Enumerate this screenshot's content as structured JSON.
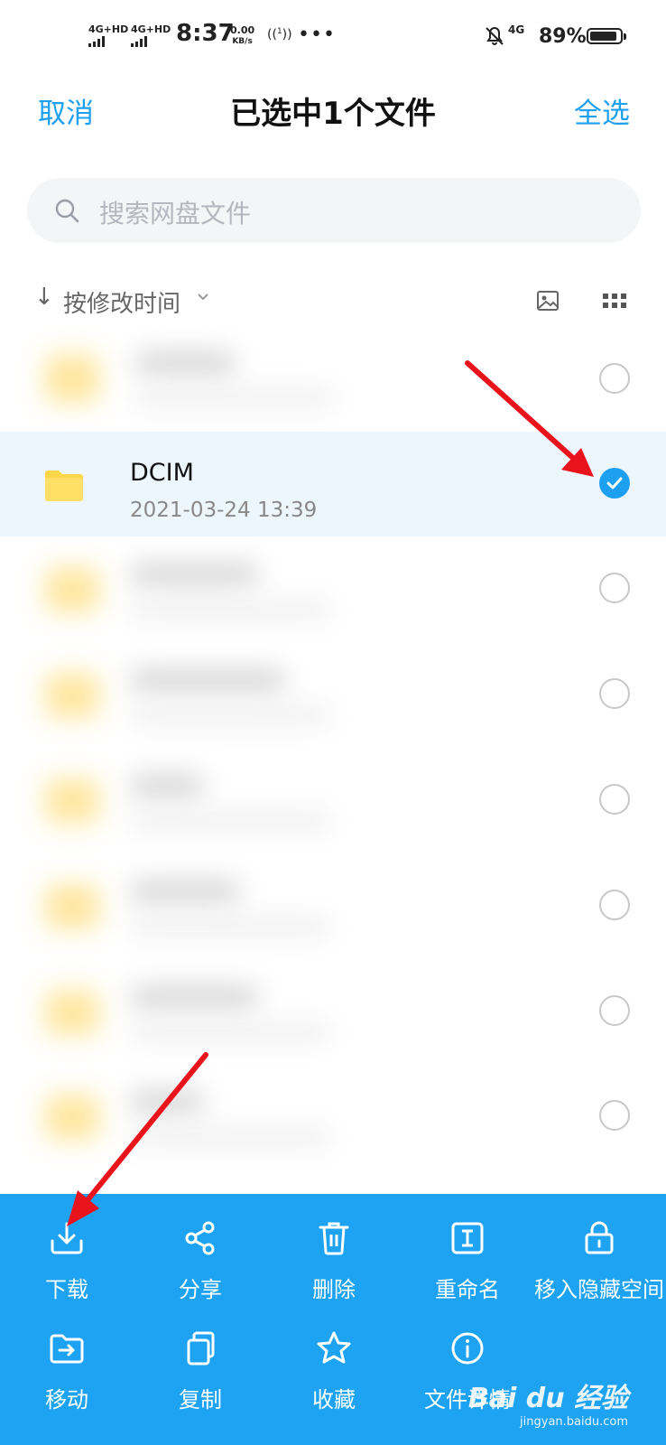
{
  "status_bar": {
    "sim1": "4G+HD",
    "sim2": "4G+HD",
    "time": "8:37",
    "speed_value": "0.00",
    "speed_unit": "KB/s",
    "hotspot_num": "1",
    "network": "4G",
    "battery_percent": "89%"
  },
  "header": {
    "cancel": "取消",
    "title": "已选中1个文件",
    "select_all": "全选"
  },
  "search": {
    "placeholder": "搜索网盘文件"
  },
  "sort": {
    "label": "按修改时间"
  },
  "files": [
    {
      "name": "",
      "date": "",
      "selected": false,
      "blurred": true
    },
    {
      "name": "DCIM",
      "date": "2021-03-24  13:39",
      "selected": true,
      "blurred": false
    },
    {
      "name": "",
      "date": "",
      "selected": false,
      "blurred": true
    },
    {
      "name": "",
      "date": "",
      "selected": false,
      "blurred": true
    },
    {
      "name": "",
      "date": "",
      "selected": false,
      "blurred": true
    },
    {
      "name": "",
      "date": "",
      "selected": false,
      "blurred": true
    },
    {
      "name": "",
      "date": "",
      "selected": false,
      "blurred": true
    },
    {
      "name": "",
      "date": "",
      "selected": false,
      "blurred": true
    }
  ],
  "actions": {
    "row1": [
      {
        "label": "下载",
        "icon": "download-icon"
      },
      {
        "label": "分享",
        "icon": "share-icon"
      },
      {
        "label": "删除",
        "icon": "trash-icon"
      },
      {
        "label": "重命名",
        "icon": "rename-icon"
      },
      {
        "label": "移入隐藏空间",
        "icon": "lock-icon"
      }
    ],
    "row2": [
      {
        "label": "移动",
        "icon": "move-icon"
      },
      {
        "label": "复制",
        "icon": "copy-icon"
      },
      {
        "label": "收藏",
        "icon": "star-icon"
      },
      {
        "label": "文件详情",
        "icon": "info-icon"
      }
    ]
  },
  "watermark": {
    "brand": "Bai du 经验",
    "url": "jingyan.baidu.com"
  },
  "colors": {
    "accent": "#1ea0f0",
    "panel": "#1ea2f2",
    "folder": "#ffd54a",
    "selected_row": "#edf6fd",
    "annotation_arrow": "#e8131b"
  }
}
